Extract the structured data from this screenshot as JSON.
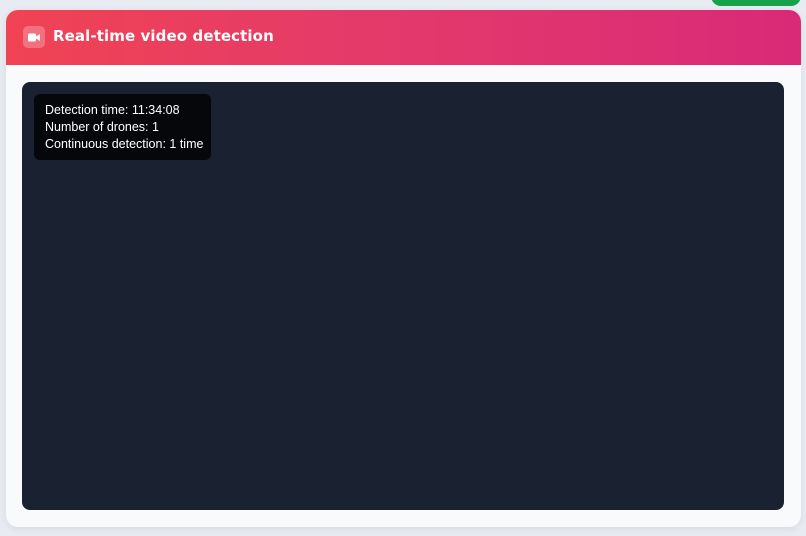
{
  "card": {
    "header": {
      "icon": "video-camera-icon",
      "title": "Real-time video detection"
    }
  },
  "overlay": {
    "detection_time": "Detection time: 11:34:08",
    "drone_count": "Number of drones: 1",
    "continuous": "Continuous detection: 1 time"
  },
  "colors": {
    "header_gradient_start": "#f04353",
    "header_gradient_end": "#d92a78",
    "video_background": "#1a2130",
    "overlay_background": "#05070b",
    "top_button": "#16a34a"
  }
}
